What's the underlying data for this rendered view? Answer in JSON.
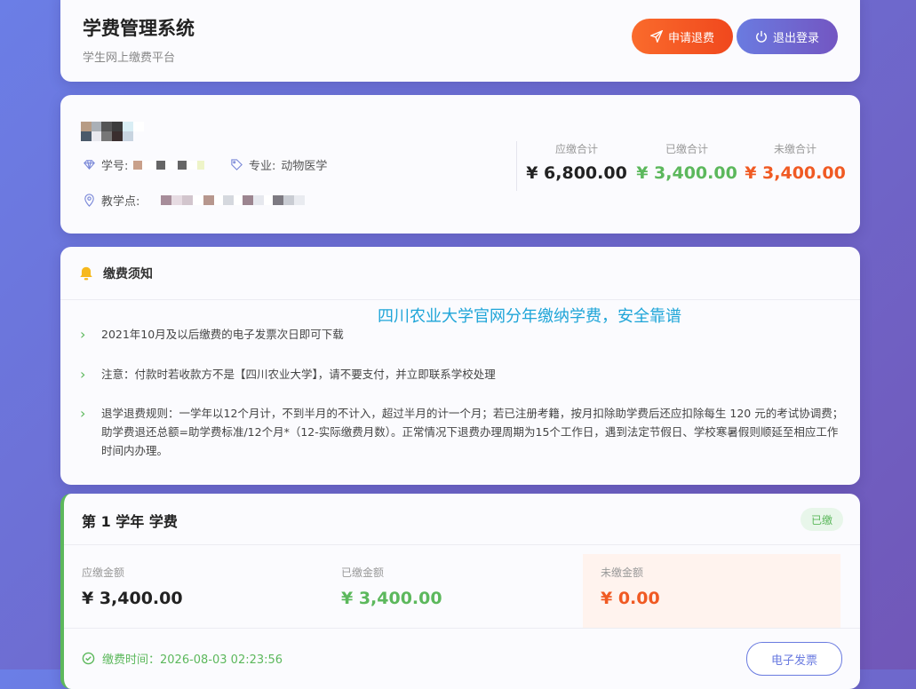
{
  "header": {
    "title": "学费管理系统",
    "subtitle": "学生网上缴费平台",
    "refund_label": "申请退费",
    "logout_label": "退出登录"
  },
  "student": {
    "student_id_label": "学号:",
    "major_label": "专业:",
    "major_value": "动物医学",
    "campus_label": "教学点:"
  },
  "summary": [
    {
      "label": "应缴合计",
      "value": "¥ 6,800.00",
      "color": "#222222"
    },
    {
      "label": "已缴合计",
      "value": "¥ 3,400.00",
      "color": "#5cb85c"
    },
    {
      "label": "未缴合计",
      "value": "¥ 3,400.00",
      "color": "#f05a23"
    }
  ],
  "notice": {
    "title": "缴费须知",
    "overlay_text": "四川农业大学官网分年缴纳学费，安全靠谱",
    "items": [
      "2021年10月及以后缴费的电子发票次日即可下载",
      "注意：付款时若收款方不是【四川农业大学】，请不要支付，并立即联系学校处理",
      "退学退费规则：一学年以12个月计，不到半月的不计入，超过半月的计一个月；若已注册考籍，按月扣除助学费后还应扣除每生 120 元的考试协调费； 助学费退还总额=助学费标准/12个月*（12-实际缴费月数）。正常情况下退费办理周期为15个工作日，遇到法定节假日、学校寒暑假则顺延至相应工作时间内办理。"
    ]
  },
  "year": {
    "title": "第 1 学年 学费",
    "status_badge": "已缴",
    "amounts": [
      {
        "label": "应缴金额",
        "value": "¥ 3,400.00",
        "color": "#222222"
      },
      {
        "label": "已缴金额",
        "value": "¥ 3,400.00",
        "color": "#5cb85c"
      },
      {
        "label": "未缴金额",
        "value": "¥ 0.00",
        "color": "#f05a23"
      }
    ],
    "paid_time": "缴费时间：2026-08-03 02:23:56",
    "invoice_label": "电子发票"
  },
  "colors": {
    "accent": "#6a7be0",
    "success": "#5cb85c",
    "warning": "#f05a23"
  }
}
